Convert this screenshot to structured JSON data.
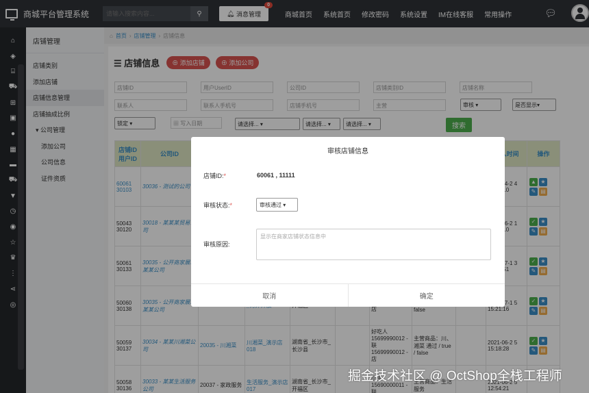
{
  "app": {
    "title": "商城平台管理系统"
  },
  "header": {
    "search_placeholder": "请输入搜索内容...",
    "message_label": "消息管理",
    "message_count": "0",
    "nav": [
      "商城首页",
      "系统首页",
      "修改密码",
      "系统设置",
      "IM在线客服",
      "常用操作"
    ]
  },
  "sidebar": {
    "title": "店铺管理",
    "items": [
      "店铺类别",
      "添加店铺",
      "店铺信息管理",
      "店铺抽成比例",
      "▾ 公司管理",
      "添加公司",
      "公司信息",
      "证件资质"
    ]
  },
  "breadcrumb": [
    "首页",
    "店铺管理",
    "店铺信息"
  ],
  "page": {
    "heading": "☰ 店铺信息",
    "add_store": "添加店铺",
    "add_company": "添加公司",
    "filters_row1": [
      "店铺ID",
      "用户UserID",
      "公司ID",
      "店铺类别ID",
      "店铺名称"
    ],
    "filters_row2": [
      "联系人",
      "联系人手机号",
      "店铺手机号",
      "主营"
    ],
    "audit_select": "审核",
    "show_select": "是否显示▾",
    "lock_select": "锁定",
    "date_placeholder": "写入日期",
    "choose1": "请选择...",
    "choose2": "请选择...",
    "choose3": "请选择...",
    "search_btn": "搜索"
  },
  "table": {
    "headers": [
      "店铺ID 用户ID",
      "公司ID",
      "写入时间",
      "操作"
    ],
    "rows": [
      {
        "ids": "60061 30103",
        "company": "30036 - 测试的公司",
        "col3": "",
        "col4": "",
        "col5": "",
        "col6": "",
        "col7": "",
        "time": "2023-04-2 4 10:55:10"
      },
      {
        "ids": "50043 30120",
        "company": "30018 - 某某某贸易公司",
        "col3": "",
        "col4": "",
        "col5": "",
        "col6": "",
        "col7": "",
        "time": "2021-06-2 1 15:15:10"
      },
      {
        "ids": "50061 30133",
        "company": "30035 - 公开商家展示某某公司",
        "col3": "",
        "col4": "",
        "col5": "",
        "col6": "",
        "col7": "",
        "time": "2022-07-1 3 18:42:51"
      },
      {
        "ids": "50060 30138",
        "company": "30035 - 公开商家展示某某公司",
        "col3": "",
        "col4": "_对外开放",
        "col5": "开福区",
        "col6": "15688886666 - 店",
        "col7": "_对外开放  / false",
        "time": "2021-07-1 5 15:21:16"
      },
      {
        "ids": "50059 30137",
        "company": "30034 - 某某川湘菜公司",
        "col3": "20035 - 川湘菜",
        "col4": "川湘菜_演示店018",
        "col5": "湖南省_长沙市_长沙县",
        "col6": "好吃人  15699990012 - 联 15699990012 - 店",
        "col7": "主营商品：川、湘菜  通过 / true / false",
        "time": "2021-06-2 5 15:18:28"
      },
      {
        "ids": "50058 30136",
        "company": "30033 - 某某生活服务公司",
        "col3": "20037 - 家政服务",
        "col4": "生活服务_演示店017",
        "col5": "湖南省_长沙市_开福区",
        "col6": "小生  15690000011 - 联",
        "col7": "主营商品：生活服务",
        "time": "2021-06-2 5 12:54:21"
      }
    ]
  },
  "modal": {
    "title": "审核店铺信息",
    "store_id_label": "店铺ID:",
    "store_id_value": "60061 , 11111",
    "status_label": "审核状态:",
    "status_value": "审核通过 ▾",
    "reason_label": "审核原因:",
    "reason_placeholder": "显示在商家店铺状态信息中",
    "cancel": "取消",
    "confirm": "确定"
  },
  "watermark": "掘金技术社区 @ OctShop全栈工程师"
}
